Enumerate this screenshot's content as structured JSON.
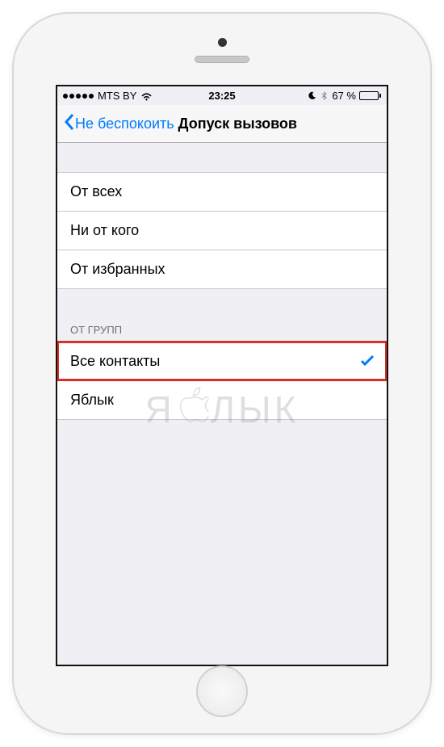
{
  "status_bar": {
    "carrier": "MTS BY",
    "time": "23:25",
    "battery_pct": "67 %"
  },
  "nav": {
    "back_label": "Не беспокоить",
    "title": "Допуск вызовов"
  },
  "section1": {
    "items": [
      {
        "label": "От всех"
      },
      {
        "label": "Ни от кого"
      },
      {
        "label": "От избранных"
      }
    ]
  },
  "section2": {
    "header": "ОТ ГРУПП",
    "items": [
      {
        "label": "Все контакты",
        "selected": true
      },
      {
        "label": "Яблык"
      }
    ]
  },
  "watermark": {
    "left": "Я",
    "right": "ЛЫК"
  }
}
